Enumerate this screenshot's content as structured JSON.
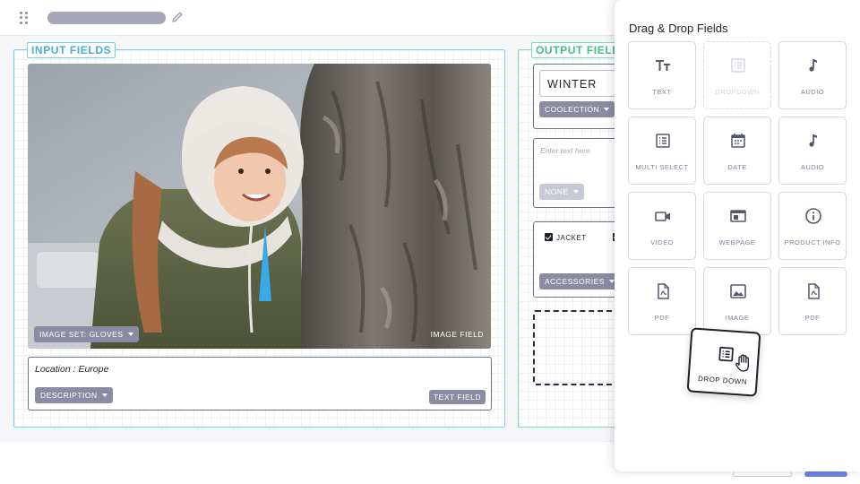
{
  "topbar": {
    "drag_icon": "drag-handle-icon",
    "edit_icon": "pencil-icon"
  },
  "input_panel": {
    "label": "INPUT FIELDS",
    "image_field": {
      "image_set_label": "IMAGE SET: GLOVES",
      "type_tag": "IMAGE FIELD"
    },
    "text_field": {
      "value": "Location : Europe",
      "type_chip": "DESCRIPTION",
      "type_tag": "TEXT FIELD"
    }
  },
  "output_panel": {
    "label": "OUTPUT FIELD",
    "collection_card": {
      "value": "WINTER",
      "chip": "COOLECTION"
    },
    "text_card": {
      "placeholder": "Enter text here",
      "chip": "NONE"
    },
    "accessories_card": {
      "checkbox_label": "JACKET",
      "chip": "ACCESSORIES"
    }
  },
  "drawer": {
    "title": "Drag & Drop Fields",
    "tiles": [
      {
        "label": "TEXT",
        "icon": "text-icon",
        "disabled": false
      },
      {
        "label": "DROPDOWN",
        "icon": "list-icon",
        "disabled": true
      },
      {
        "label": "AUDIO",
        "icon": "music-note-icon",
        "disabled": false
      },
      {
        "label": "MULTI SELECT",
        "icon": "list-icon",
        "disabled": false
      },
      {
        "label": "DATE",
        "icon": "calendar-icon",
        "disabled": false
      },
      {
        "label": "AUDIO",
        "icon": "music-note-icon",
        "disabled": false
      },
      {
        "label": "VIDEO",
        "icon": "video-camera-icon",
        "disabled": false
      },
      {
        "label": "WEBPAGE",
        "icon": "browser-window-icon",
        "disabled": false
      },
      {
        "label": "PRODUCT INFO",
        "icon": "info-icon",
        "disabled": false
      },
      {
        "label": "PDF",
        "icon": "pdf-file-icon",
        "disabled": false
      },
      {
        "label": "IMAGE",
        "icon": "image-icon",
        "disabled": false
      },
      {
        "label": "PDF",
        "icon": "pdf-file-icon",
        "disabled": false
      }
    ],
    "dragging_tile": {
      "label": "DROP DOWN",
      "icon": "list-icon",
      "cursor": "grab-hand-icon"
    }
  },
  "colors": {
    "input_accent": "#4aaed0",
    "output_accent": "#3fbf82",
    "chip": "#8b8ca3",
    "primary": "#6d82e8"
  }
}
